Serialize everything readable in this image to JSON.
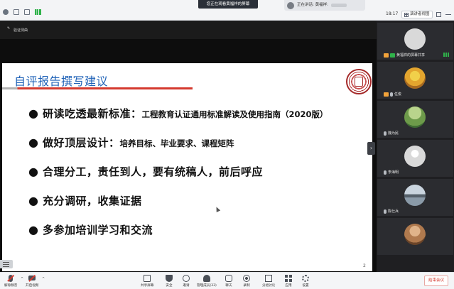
{
  "topbar": {
    "share_notice": "您正在观看黄福祥的屏幕",
    "speaking_label": "正在讲话: 黄福祥:",
    "clock": "18:17",
    "view_button_label": "演讲者视图"
  },
  "stage": {
    "header_text": "验证测曲"
  },
  "slide": {
    "title": "自评报告撰写建议",
    "bullets": [
      {
        "strong": "研读吃透最新标准：",
        "sub": "工程教育认证通用标准解读及使用指南（2020版）"
      },
      {
        "strong": "做好顶层设计：",
        "sub": "培养目标、毕业要求、课程矩阵"
      },
      {
        "strong": "合理分工，责任到人，要有统稿人，前后呼应",
        "sub": ""
      },
      {
        "strong": "充分调研，收集证据",
        "sub": ""
      },
      {
        "strong": "多参加培训学习和交流",
        "sub": ""
      }
    ],
    "bullet_symbol": "●",
    "page_number": "2"
  },
  "participants": [
    {
      "name": "黄福祥的屏幕共享",
      "avatar_color": "#d9d9d9"
    },
    {
      "name": "任俊",
      "avatar_color": "#e3a52e"
    },
    {
      "name": "魏为民",
      "avatar_color": "#7aa35a"
    },
    {
      "name": "李海明",
      "avatar_color": "#d9d9d9"
    },
    {
      "name": "陈仕兵",
      "avatar_color": "#8a9aa8"
    },
    {
      "name": "",
      "avatar_color": "#b07a4e"
    }
  ],
  "toolbar": {
    "mute_label": "解除静音",
    "video_label": "开启视频",
    "share_label": "共享屏幕",
    "security_label": "安全",
    "invite_label": "邀请",
    "participants_label": "管理成员(33)",
    "chat_label": "聊天",
    "record_label": "录制",
    "breakout_label": "分组讨论",
    "apps_label": "应用",
    "settings_label": "设置",
    "end_label": "结束会议"
  }
}
